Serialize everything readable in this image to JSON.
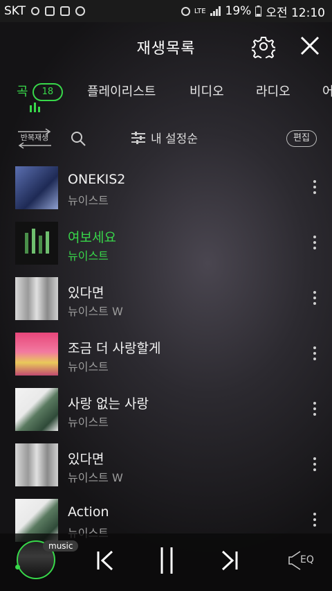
{
  "status": {
    "carrier": "SKT",
    "network": "LTE",
    "battery": "19%",
    "time": "오전 12:10"
  },
  "header": {
    "title": "재생목록"
  },
  "tabs": [
    {
      "label": "곡",
      "badge": "18"
    },
    {
      "label": "플레이리스트"
    },
    {
      "label": "비디오"
    },
    {
      "label": "라디오"
    },
    {
      "label": "어"
    }
  ],
  "controls": {
    "repeat_label": "반복재생",
    "sort_label": "내 설정순",
    "edit_label": "편집"
  },
  "songs": [
    {
      "title": "ONEKIS2",
      "artist": "뉴이스트",
      "playing": false
    },
    {
      "title": "여보세요",
      "artist": "뉴이스트",
      "playing": true
    },
    {
      "title": "있다면",
      "artist": "뉴이스트 W",
      "playing": false
    },
    {
      "title": "조금 더 사랑할게",
      "artist": "뉴이스트",
      "playing": false
    },
    {
      "title": "사랑 없는 사랑",
      "artist": "뉴이스트",
      "playing": false
    },
    {
      "title": "있다면",
      "artist": "뉴이스트 W",
      "playing": false
    },
    {
      "title": "Action",
      "artist": "뉴이스트",
      "playing": false
    }
  ],
  "player": {
    "tag": "music",
    "eq_label": "EQ"
  },
  "colors": {
    "accent": "#38d84a"
  }
}
